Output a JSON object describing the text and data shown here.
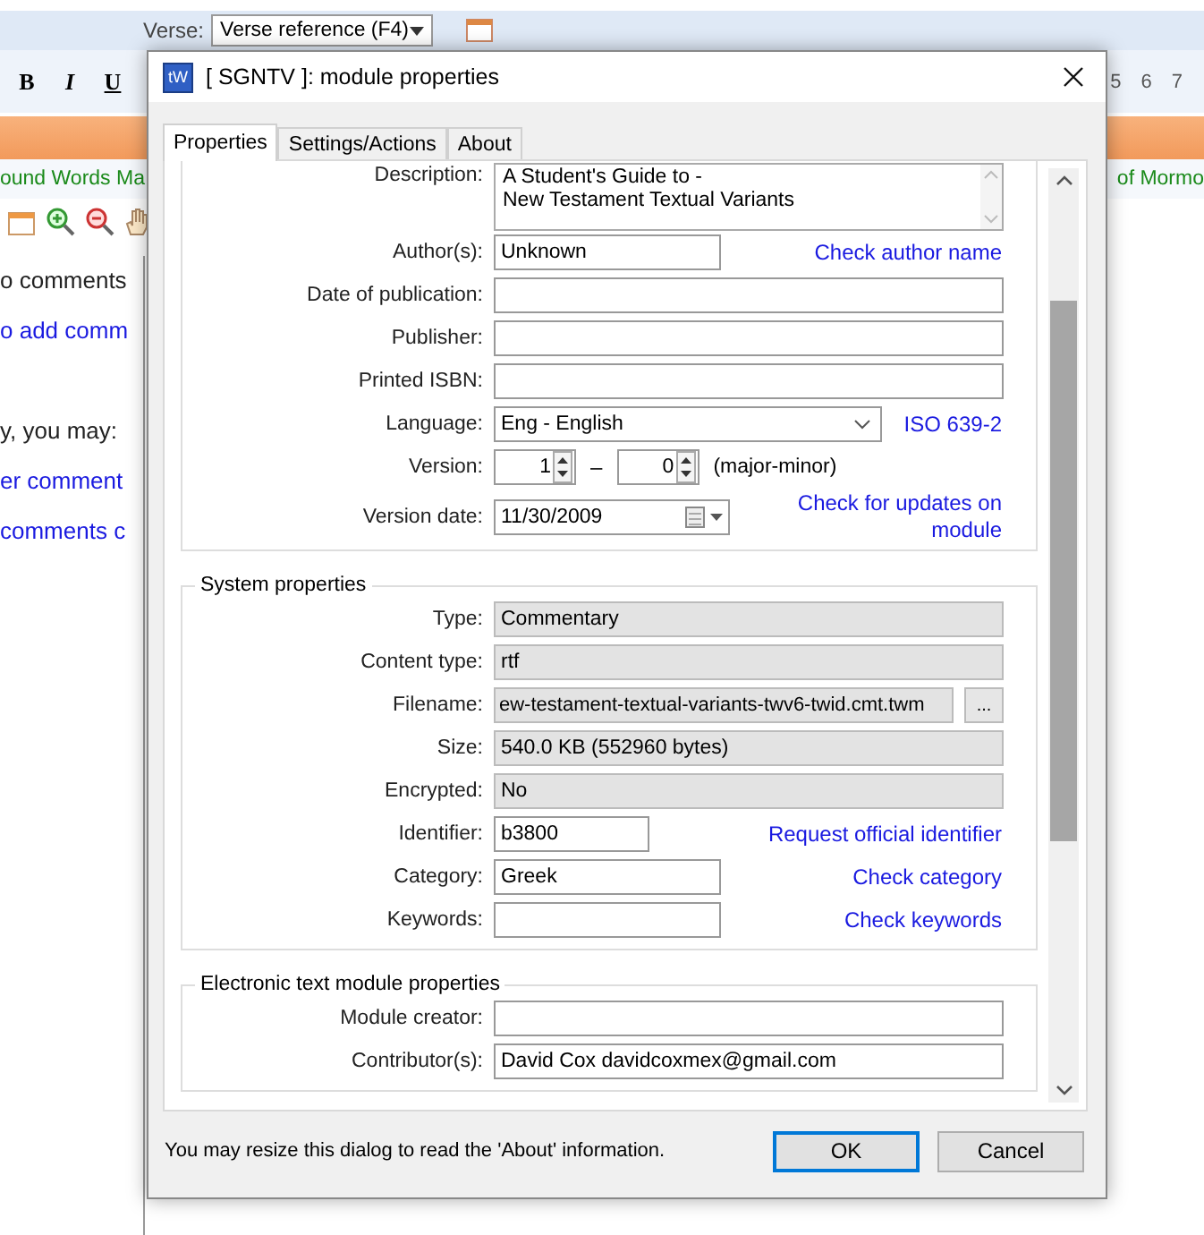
{
  "background_app": {
    "verse_label": "Verse:",
    "verse_dropdown": "Verse reference (F4)",
    "format_buttons": [
      "B",
      "I",
      "U"
    ],
    "page_numbers": [
      "5",
      "6",
      "7"
    ],
    "left_tab_title": "ound Words Ma",
    "right_tab_title": "of Mormo",
    "text_lines": [
      {
        "text": "o comments",
        "kind": "plain"
      },
      {
        "text": "o add comm",
        "kind": "link"
      },
      {
        "text": "y, you may:",
        "kind": "plain"
      },
      {
        "text": "er comment",
        "kind": "link"
      },
      {
        "text": "comments c",
        "kind": "link"
      }
    ]
  },
  "dialog": {
    "app_icon_text": "tW",
    "title": "[ SGNTV ]: module properties",
    "tabs": [
      {
        "label": "Properties",
        "selected": true
      },
      {
        "label": "Settings/Actions",
        "selected": false
      },
      {
        "label": "About",
        "selected": false
      }
    ],
    "description": {
      "label": "Description:",
      "lines": [
        "A Student's Guide to -",
        "New Testament Textual Variants"
      ]
    },
    "fields": [
      {
        "kind": "short",
        "label": "Author(s):",
        "value": "Unknown",
        "link": "Check author name"
      },
      {
        "kind": "wide",
        "label": "Date of publication:"
      },
      {
        "kind": "wide",
        "label": "Publisher:"
      },
      {
        "kind": "wide",
        "label": "Printed ISBN:"
      },
      {
        "kind": "select",
        "label": "Language:",
        "value": "Eng - English",
        "link": "ISO 639-2"
      },
      {
        "kind": "version",
        "label": "Version:",
        "major": "1",
        "dash": "–",
        "minor": "0",
        "note": "(major-minor)"
      },
      {
        "kind": "date",
        "label": "Version date:",
        "value": "11/30/2009",
        "link": "Check for updates on module"
      }
    ],
    "system": {
      "title": "System properties",
      "fields": [
        {
          "kind": "readonly",
          "label": "Type:",
          "value": "Commentary"
        },
        {
          "kind": "readonly",
          "label": "Content type:",
          "value": "rtf"
        },
        {
          "kind": "file",
          "label": "Filename:",
          "value": "ew-testament-textual-variants-twv6-twid.cmt.twm",
          "button": "..."
        },
        {
          "kind": "readonly",
          "label": "Size:",
          "value": "540.0 KB (552960 bytes)"
        },
        {
          "kind": "readonly",
          "label": "Encrypted:",
          "value": "No"
        },
        {
          "kind": "tiny",
          "label": "Identifier:",
          "value": "b3800",
          "link": "Request official identifier"
        },
        {
          "kind": "short",
          "label": "Category:",
          "value": "Greek",
          "link": "Check category"
        },
        {
          "kind": "short",
          "label": "Keywords:",
          "link": "Check keywords"
        }
      ]
    },
    "electronic": {
      "title": "Electronic text module properties",
      "fields": [
        {
          "kind": "wide",
          "label": "Module creator:"
        },
        {
          "kind": "wide",
          "label": "Contributor(s):",
          "value": "David Cox davidcoxmex@gmail.com"
        }
      ]
    },
    "note": "You may resize this dialog to read the 'About' information.",
    "buttons": [
      {
        "label": "OK",
        "default": true
      },
      {
        "label": "Cancel",
        "default": false
      }
    ]
  }
}
